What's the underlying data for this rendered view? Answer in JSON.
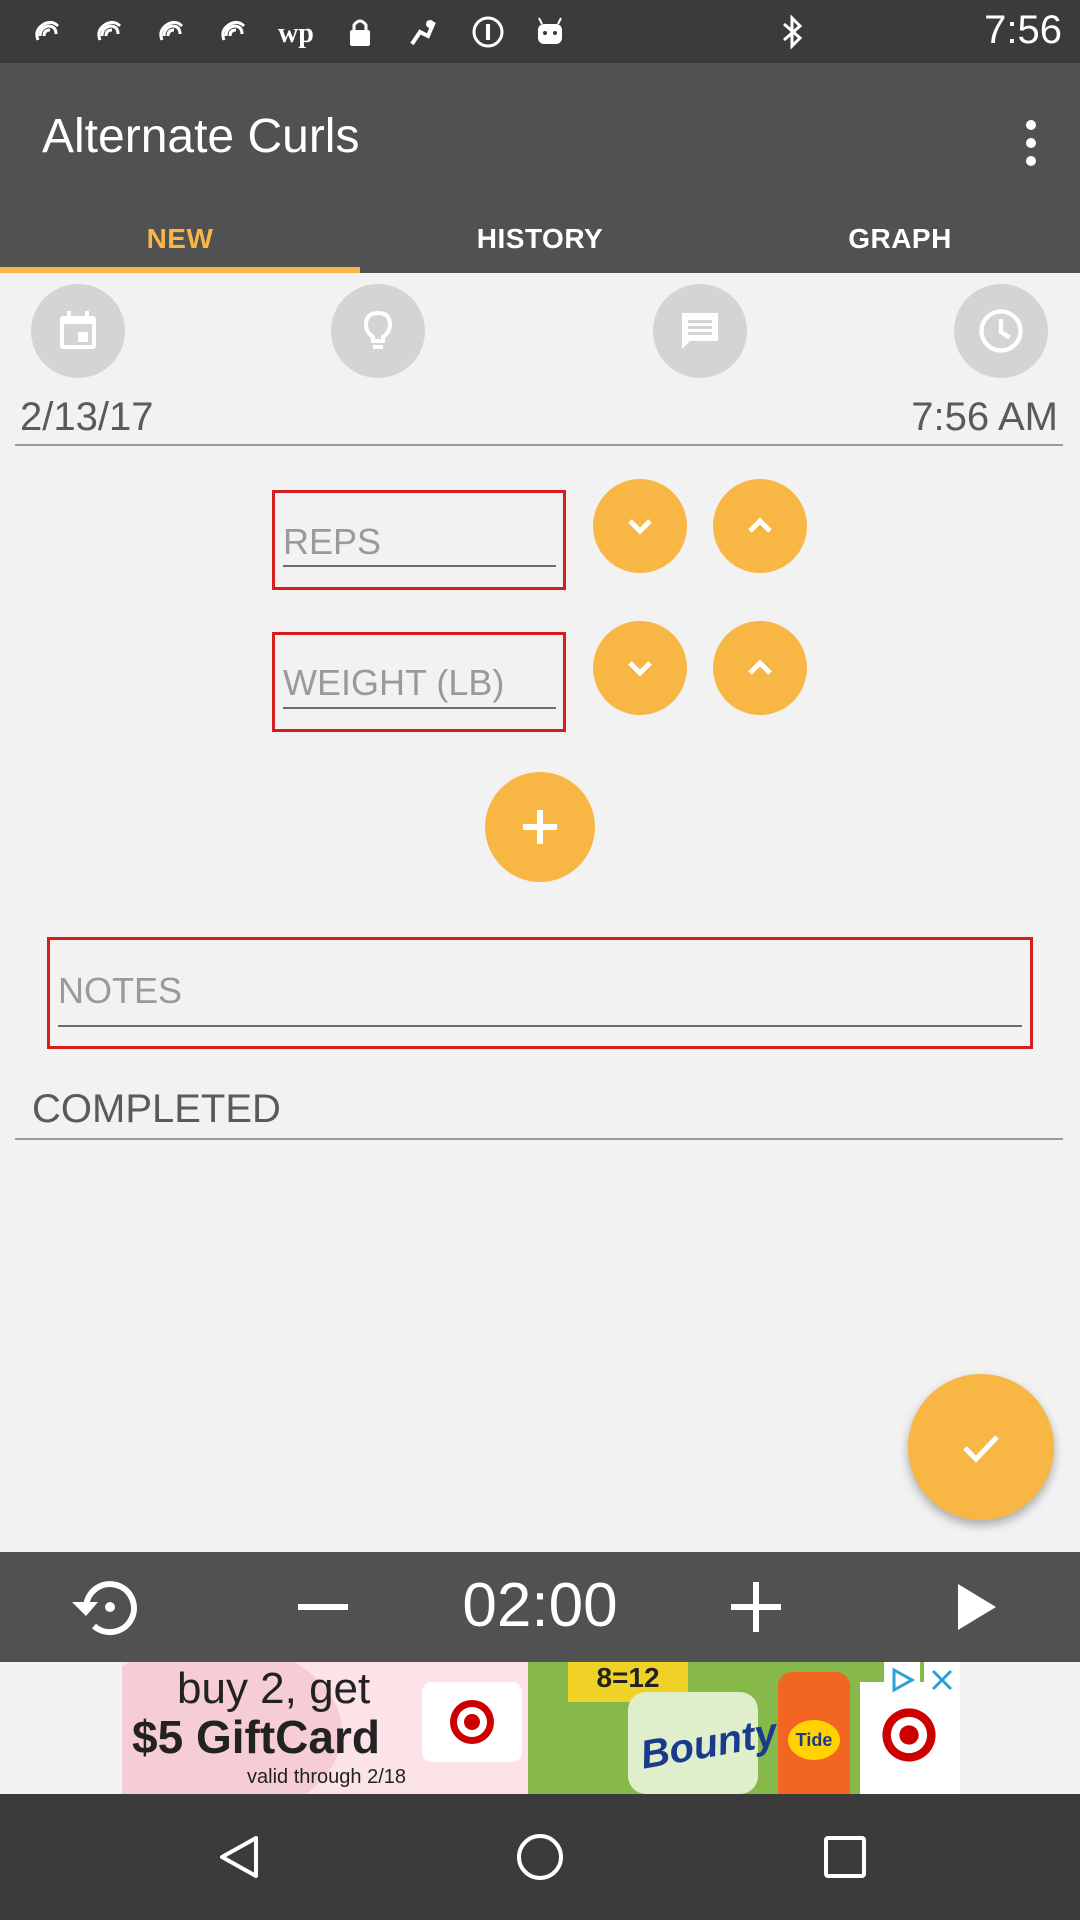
{
  "status_bar": {
    "time": "7:56",
    "icons": [
      "fitbit-icon",
      "fitbit-icon",
      "fitbit-icon",
      "fitbit-icon",
      "washington-post-icon",
      "lock-icon",
      "fake-gps-icon",
      "info-icon",
      "android-icon",
      "bluetooth-icon"
    ]
  },
  "app_bar": {
    "title": "Alternate Curls",
    "tabs": [
      {
        "label": "NEW",
        "selected": true
      },
      {
        "label": "HISTORY",
        "selected": false
      },
      {
        "label": "GRAPH",
        "selected": false
      }
    ]
  },
  "toolbar_icons": [
    "calendar-icon",
    "lightbulb-icon",
    "comment-icon",
    "clock-icon"
  ],
  "date": "2/13/17",
  "time": "7:56 AM",
  "reps": {
    "placeholder": "REPS",
    "value": ""
  },
  "weight": {
    "placeholder": "WEIGHT (LB)",
    "value": ""
  },
  "notes": {
    "placeholder": "NOTES",
    "value": ""
  },
  "completed_label": "COMPLETED",
  "timer": {
    "value": "02:00"
  },
  "ad": {
    "line1": "buy 2, get",
    "line2": "$5 GiftCard",
    "line3": "valid through 2/18",
    "pack": "8=12",
    "brand": "Bounty",
    "brand2": "Tide"
  },
  "colors": {
    "accent": "#f8b744",
    "appbar": "#515151",
    "statusbar": "#3b3b3b",
    "error": "#d61e1e",
    "background": "#f2f2f2"
  }
}
